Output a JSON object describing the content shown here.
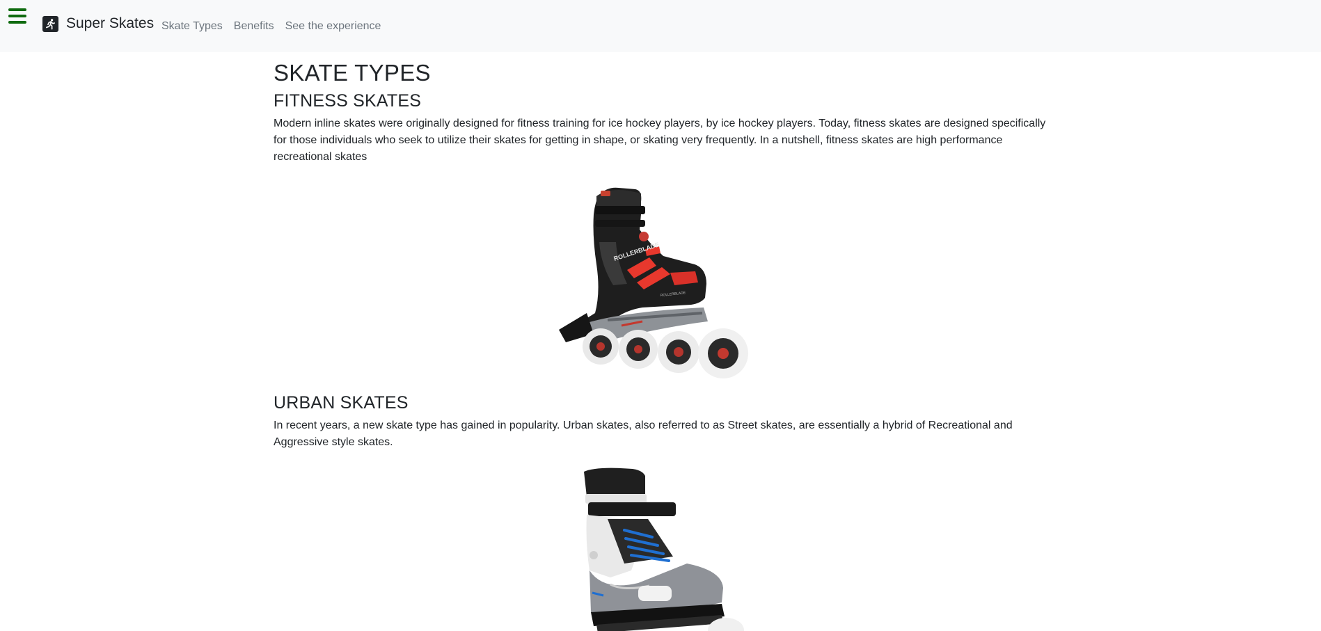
{
  "navbar": {
    "brand_name": "Super Skates",
    "brand_icon": "running-person-icon",
    "links": [
      {
        "label": "Skate Types"
      },
      {
        "label": "Benefits"
      },
      {
        "label": "See the experience"
      }
    ]
  },
  "main": {
    "page_title": "SKATE TYPES",
    "sections": [
      {
        "title": "FITNESS SKATES",
        "text": "Modern inline skates were originally designed for fitness training for ice hockey players, by ice hockey players. Today, fitness skates are designed specifically for those individuals who seek to utilize their skates for getting in shape, or skating very frequently. In a nutshell, fitness skates are high performance recreational skates",
        "image_brand_text": "ROLLERBLADE"
      },
      {
        "title": "URBAN SKATES",
        "text": "In recent years, a new skate type has gained in popularity. Urban skates, also referred to as Street skates, are essentially a hybrid of Recreational and Aggressive style skates."
      }
    ]
  },
  "colors": {
    "navbar_bg": "#f8f9fa",
    "hamburger": "#0f6b0f",
    "nav_link": "#6c757d",
    "text": "#212529",
    "fitness_accent": "#e8382d",
    "urban_accent": "#1f6fd1"
  }
}
